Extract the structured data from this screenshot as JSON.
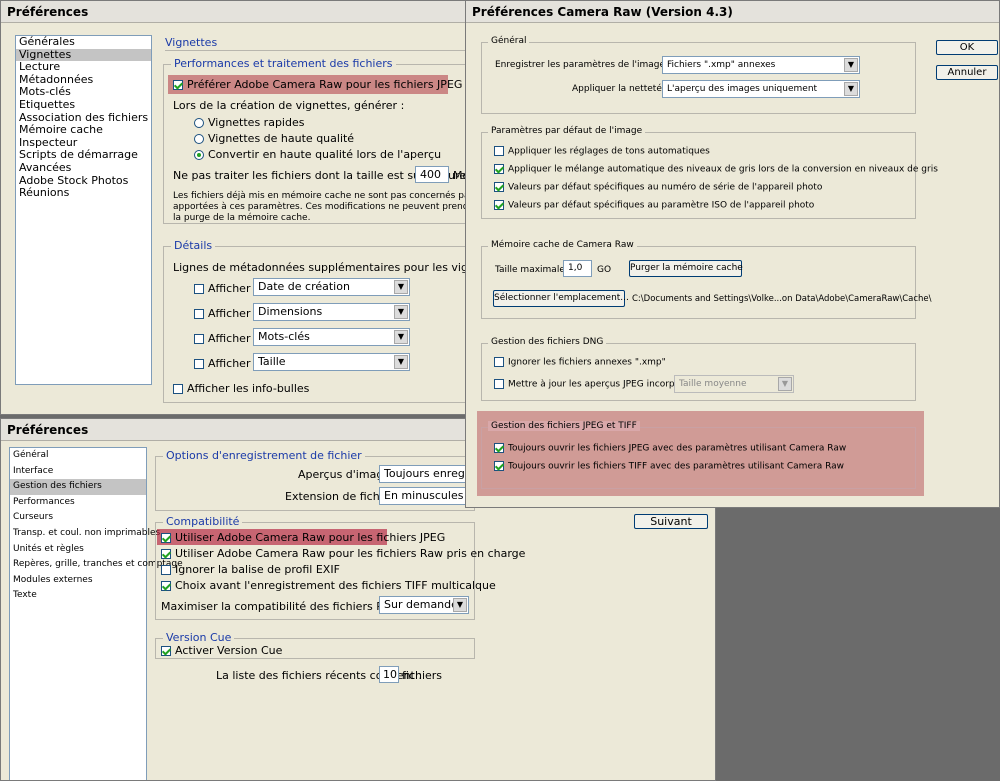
{
  "bridge": {
    "title": "Préférences",
    "nav": [
      "Générales",
      "Vignettes",
      "Lecture",
      "Métadonnées",
      "Mots-clés",
      "Etiquettes",
      "Association des fichiers",
      "Mémoire cache",
      "Inspecteur",
      "Scripts de démarrage",
      "Avancées",
      "Adobe Stock Photos",
      "Réunions"
    ],
    "section": "Vignettes",
    "perf": {
      "title": "Performances et traitement des fichiers",
      "prefer_acr": "Préférer Adobe Camera Raw pour les fichiers JPEG et TIFF",
      "gen_label": "Lors de la création de vignettes, générer :",
      "radios": [
        "Vignettes rapides",
        "Vignettes de haute qualité",
        "Convertir en haute qualité lors de l'aperçu"
      ],
      "limit_label": "Ne pas traiter les fichiers dont la taille est supérieure à :",
      "limit_value": "400",
      "limit_unit": "Mo",
      "note1": "Les fichiers déjà mis en mémoire cache ne sont pas concernés par les modifica",
      "note2": "apportées à ces paramètres. Ces modifications ne peuvent prendre effet qu'a",
      "note3": "la purge de la mémoire cache."
    },
    "details": {
      "title": "Détails",
      "meta_label": "Lignes de métadonnées supplémentaires pour les vignettes",
      "show_label": "Afficher :",
      "rows": [
        "Date de création",
        "Dimensions",
        "Mots-clés",
        "Taille"
      ],
      "tooltips": "Afficher les info-bulles"
    }
  },
  "ps": {
    "title": "Préférences",
    "nav": [
      "Général",
      "Interface",
      "Gestion des fichiers",
      "Performances",
      "Curseurs",
      "Transp. et coul. non imprimables",
      "Unités et règles",
      "Repères, grille, tranches et comptage",
      "Modules externes",
      "Texte"
    ],
    "save": {
      "title": "Options d'enregistrement de fichier",
      "preview_label": "Aperçus d'image :",
      "preview_value": "Toujours enregistre",
      "ext_label": "Extension de fichier :",
      "ext_value": "En minuscules"
    },
    "compat": {
      "title": "Compatibilité",
      "items": [
        "Utiliser Adobe Camera Raw pour les fichiers JPEG",
        "Utiliser Adobe Camera Raw pour les fichiers Raw pris en charge",
        "Ignorer la balise de profil EXIF",
        "Choix avant l'enregistrement des fichiers TIFF multicalque"
      ],
      "psd_label": "Maximiser la compatibilité des fichiers PSD et PSB :",
      "psd_value": "Sur demande"
    },
    "vc": {
      "title": "Version Cue",
      "enable": "Activer Version Cue"
    },
    "recent_label": "La liste des fichiers récents contient :",
    "recent_value": "10",
    "recent_unit": "fichiers",
    "next_button": "Suivant"
  },
  "acr": {
    "title": "Préférences Camera Raw  (Version 4.3)",
    "ok": "OK",
    "cancel": "Annuler",
    "general": {
      "title": "Général",
      "save_label": "Enregistrer les paramètres de l'image dans :",
      "save_value": "Fichiers \".xmp\" annexes",
      "sharpen_label": "Appliquer la netteté à :",
      "sharpen_value": "L'aperçu des images uniquement"
    },
    "defaults": {
      "title": "Paramètres par défaut de l'image",
      "items": [
        "Appliquer les réglages de tons automatiques",
        "Appliquer le mélange automatique des niveaux de gris lors de la conversion en niveaux de gris",
        "Valeurs par défaut spécifiques au numéro de série de l'appareil photo",
        "Valeurs par défaut spécifiques au paramètre ISO de l'appareil photo"
      ]
    },
    "cache": {
      "title": "Mémoire cache de Camera Raw",
      "max_label": "Taille maximale :",
      "max_value": "1,0",
      "max_unit": "GO",
      "purge": "Purger la mémoire cache",
      "select": "Sélectionner l'emplacement...",
      "path": "C:\\Documents and Settings\\Volke...on Data\\Adobe\\CameraRaw\\Cache\\"
    },
    "dng": {
      "title": "Gestion des fichiers DNG",
      "ignore": "Ignorer les fichiers annexes \".xmp\"",
      "update": "Mettre à jour les aperçus JPEG incorporés :",
      "update_value": "Taille moyenne"
    },
    "jpeg": {
      "title": "Gestion des fichiers JPEG et TIFF",
      "items": [
        "Toujours ouvrir les fichiers JPEG avec des paramètres utilisant Camera Raw",
        "Toujours ouvrir les fichiers TIFF avec des paramètres utilisant Camera Raw"
      ]
    }
  }
}
